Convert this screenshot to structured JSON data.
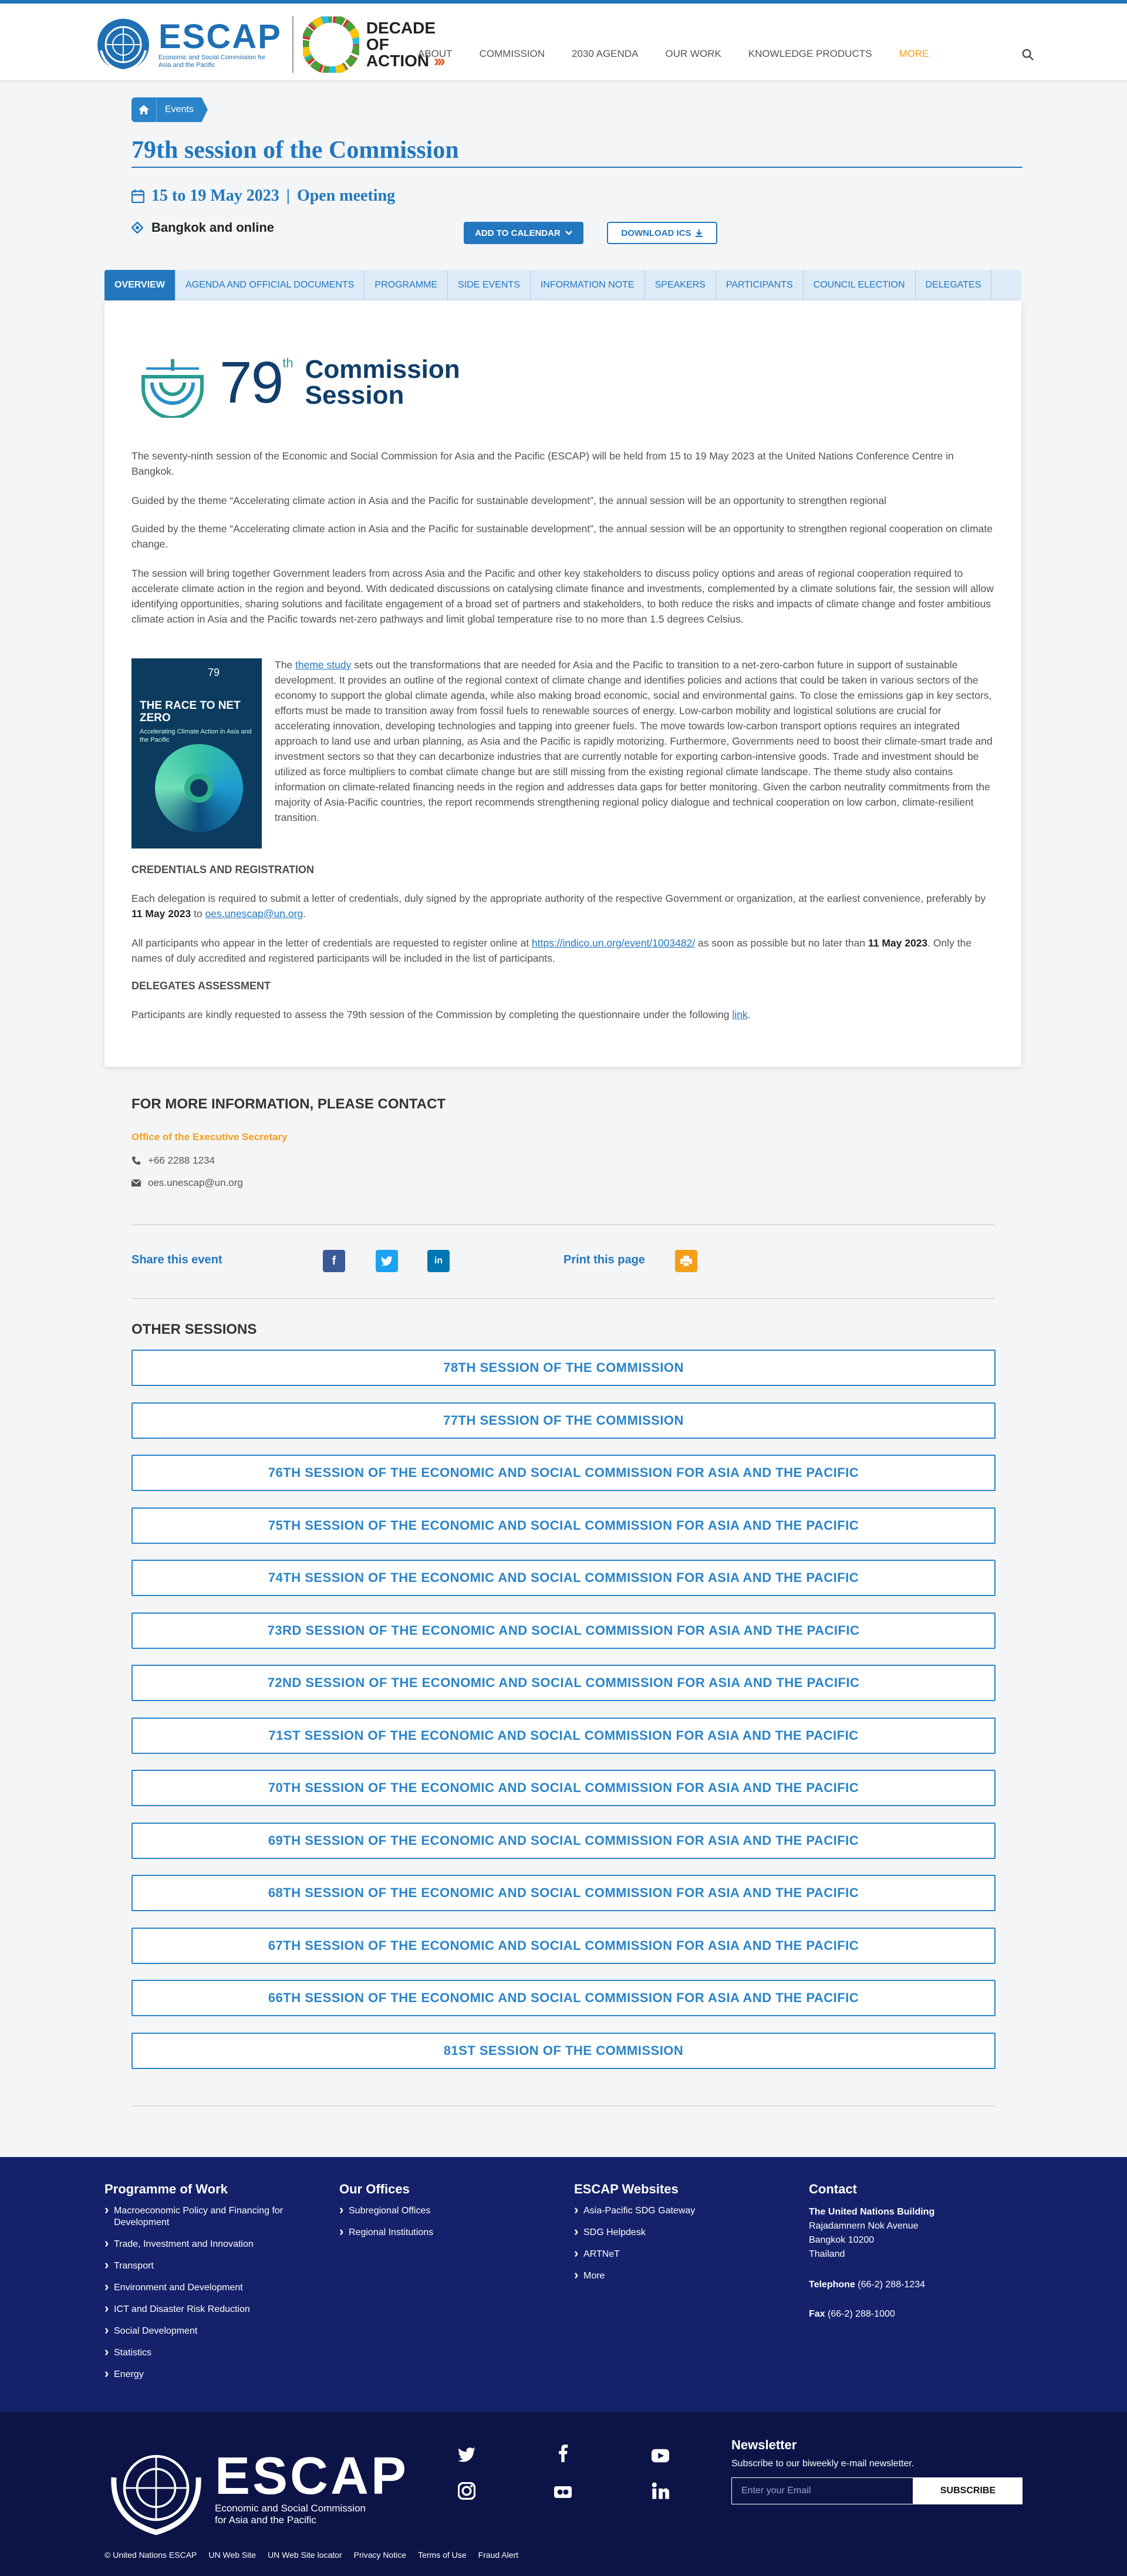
{
  "header": {
    "logo_word": "ESCAP",
    "logo_sub": "Economic and Social Commission for Asia and the Pacific",
    "decade_line1": "DECADE",
    "decade_line2": "OF",
    "decade_line3": "ACTION",
    "nav": [
      "ABOUT",
      "COMMISSION",
      "2030 AGENDA",
      "OUR WORK",
      "KNOWLEDGE PRODUCTS",
      "MORE"
    ],
    "accent": "#f49f1a",
    "brand": "#2277bf"
  },
  "breadcrumb": {
    "events": "Events"
  },
  "event": {
    "title": "79th session of the Commission",
    "dates": "15 to 19 May 2023",
    "separator": "|",
    "meeting_type": "Open meeting",
    "location": "Bangkok and online",
    "add_calendar": "ADD TO CALENDAR",
    "download_ics": "DOWNLOAD ICS"
  },
  "tabs": [
    "OVERVIEW",
    "AGENDA AND OFFICIAL DOCUMENTS",
    "PROGRAMME",
    "SIDE EVENTS",
    "INFORMATION NOTE",
    "SPEAKERS",
    "PARTICIPANTS",
    "COUNCIL ELECTION",
    "DELEGATES"
  ],
  "overview": {
    "logo_num": "79",
    "logo_th": "th",
    "logo_line1": "Commission",
    "logo_line2": "Session",
    "p1": "The seventy-ninth session of the Economic and Social Commission for Asia and the Pacific (ESCAP) will be held from 15 to 19 May 2023 at the United Nations Conference Centre in Bangkok.",
    "p2": "Guided by the theme “Accelerating climate action in Asia and the Pacific for sustainable development”, the annual session will be an opportunity to strengthen regional",
    "p3": "Guided by the theme “Accelerating climate action in Asia and the Pacific for sustainable development”, the annual session will be an opportunity to strengthen regional cooperation on climate change.",
    "p4": "The session will bring together Government leaders from across Asia and the Pacific and other key stakeholders to discuss policy options and areas of regional cooperation required to accelerate climate action in the region and beyond. With dedicated discussions on catalysing climate finance and investments, complemented by a climate solutions fair, the session will allow identifying opportunities, sharing solutions and facilitate engagement of a broad set of partners and stakeholders, to both reduce the risks and impacts of climate change and foster ambitious climate action in Asia and the Pacific towards net-zero pathways and limit global temperature rise to no more than 1.5 degrees Celsius.",
    "cover_head": "79",
    "cover_title": "THE RACE TO NET ZERO",
    "cover_sub": "Accelerating Climate Action in Asia and the Pacific",
    "study_pre": "The ",
    "study_link": "theme study",
    "study_post": " sets out the transformations that are needed for Asia and the Pacific to transition to a net-zero-carbon future in support of sustainable development. It provides an outline of the regional context of climate change and identifies policies and actions that could be taken in various sectors of the economy to support the global climate agenda, while also making broad economic, social and environmental gains. To close the emissions gap in key sectors, efforts must be made to transition away from fossil fuels to renewable sources of energy. Low-carbon mobility and logistical solutions are crucial for accelerating innovation, developing technologies and tapping into greener fuels. The move towards low-carbon transport options requires an integrated approach to land use and urban planning, as Asia and the Pacific is rapidly motorizing. Furthermore, Governments need to boost their climate-smart trade and investment sectors so that they can decarbonize industries that are currently notable for exporting carbon-intensive goods. Trade and investment should be utilized as force multipliers to combat climate change but are still missing from the existing regional climate landscape. The theme study also contains information on climate-related financing needs in the region and addresses data gaps for better monitoring. Given the carbon neutrality commitments from the majority of Asia-Pacific countries, the report recommends strengthening regional policy dialogue and technical cooperation on low carbon, climate-resilient transition.",
    "cred_head": "CREDENTIALS AND REGISTRATION",
    "cred1_pre": "Each delegation is required to submit a letter of credentials, duly signed by the appropriate authority of the respective Government or organization, at the earliest convenience, preferably by ",
    "cred1_date": "11 May 2023",
    "cred1_mid": " to ",
    "cred1_email": "oes.unescap@un.org",
    "cred1_end": ".",
    "cred2_pre": "All participants who appear in the letter of credentials are requested to register online at ",
    "cred2_link": "https://indico.un.org/event/1003482/",
    "cred2_mid": " as soon as possible but no later than ",
    "cred2_date": "11 May 2023",
    "cred2_end": ". Only the names of duly accredited and registered participants will be included in the list of participants.",
    "del_head": "DELEGATES ASSESSMENT",
    "del_pre": "Participants are kindly requested to assess the 79th session of the Commission by completing the questionnaire under the following ",
    "del_link": "link",
    "del_end": "."
  },
  "contact": {
    "title": "FOR MORE INFORMATION, PLEASE CONTACT",
    "office": "Office of the Executive Secretary",
    "phone": "+66 2288 1234",
    "email": "oes.unescap@un.org"
  },
  "share": {
    "label": "Share this event",
    "facebook": "f",
    "twitter": "t",
    "linkedin": "in",
    "print": "Print this page"
  },
  "other_sessions": {
    "title": "OTHER SESSIONS",
    "items": [
      "78TH SESSION OF THE COMMISSION",
      "77TH SESSION OF THE COMMISSION",
      "76TH SESSION OF THE ECONOMIC AND SOCIAL COMMISSION FOR ASIA AND THE PACIFIC",
      "75TH SESSION OF THE ECONOMIC AND SOCIAL COMMISSION FOR ASIA AND THE PACIFIC",
      "74TH SESSION OF THE ECONOMIC AND SOCIAL COMMISSION FOR ASIA AND THE PACIFIC",
      "73RD SESSION OF THE ECONOMIC AND SOCIAL COMMISSION FOR ASIA AND THE PACIFIC",
      "72ND SESSION OF THE ECONOMIC AND SOCIAL COMMISSION FOR ASIA AND THE PACIFIC",
      "71ST SESSION OF THE ECONOMIC AND SOCIAL COMMISSION FOR ASIA AND THE PACIFIC",
      "70TH SESSION OF THE ECONOMIC AND SOCIAL COMMISSION FOR ASIA AND THE PACIFIC",
      "69TH SESSION OF THE ECONOMIC AND SOCIAL COMMISSION FOR ASIA AND THE PACIFIC",
      "68TH SESSION OF THE ECONOMIC AND SOCIAL COMMISSION FOR ASIA AND THE PACIFIC",
      "67TH SESSION OF THE ECONOMIC AND SOCIAL COMMISSION FOR ASIA AND THE PACIFIC",
      "66TH SESSION OF THE ECONOMIC AND SOCIAL COMMISSION FOR ASIA AND THE PACIFIC",
      "81ST SESSION OF THE COMMISSION"
    ]
  },
  "footer": {
    "programme_title": "Programme of Work",
    "programme": [
      "Macroeconomic Policy and Financing for Development",
      "Trade, Investment and Innovation",
      "Transport",
      "Environment and Development",
      "ICT and Disaster Risk Reduction",
      "Social Development",
      "Statistics",
      "Energy"
    ],
    "offices_title": "Our Offices",
    "offices": [
      "Subregional Offices",
      "Regional Institutions"
    ],
    "websites_title": "ESCAP Websites",
    "websites": [
      "Asia-Pacific SDG Gateway",
      "SDG Helpdesk",
      "ARTNeT",
      "More"
    ],
    "contact_title": "Contact",
    "addr_name": "The United Nations Building",
    "addr1": "Rajadamnern Nok Avenue",
    "addr2": "Bangkok 10200",
    "addr3": "Thailand",
    "tel_label": "Telephone",
    "tel": "(66-2) 288-1234",
    "fax_label": "Fax",
    "fax": "(66-2) 288-1000",
    "logo_word": "ESCAP",
    "logo_sub1": "Economic and Social Commission",
    "logo_sub2": "for Asia and the Pacific",
    "newsletter_title": "Newsletter",
    "newsletter_sub": "Subscribe to our biweekly e-mail newsletter.",
    "email_placeholder": "Enter your Email",
    "subscribe": "SUBSCRIBE",
    "bottom": [
      "© United Nations ESCAP",
      "UN Web Site",
      "UN Web Site locator",
      "Privacy Notice",
      "Terms of Use",
      "Fraud Alert"
    ],
    "bg": "#15216a"
  }
}
